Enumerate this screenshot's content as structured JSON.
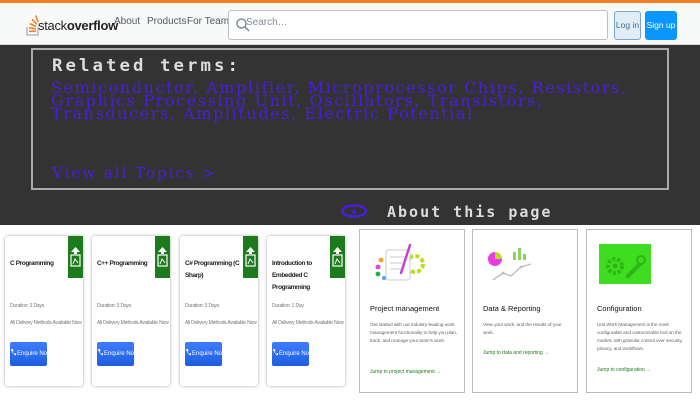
{
  "header": {
    "logo_text_light": "stack",
    "logo_text_bold": "overflow",
    "nav": [
      "About",
      "Products",
      "For Teams"
    ],
    "search_placeholder": "Search…",
    "login_label": "Log in",
    "signup_label": "Sign up"
  },
  "related": {
    "title": "Related terms:",
    "terms": "Semiconductor, Amplifier, Microprocessor Chips, Resistors, Graphics Processing Unit, Oscillators, Transistors, Transducers, Amplitudes, Electric Potential",
    "view_all": "View all Topics >",
    "about": "About this page"
  },
  "courses": [
    {
      "title": "C Programming",
      "duration": "Duration: 3 Days",
      "delivery": "All Delivery Methods Available Now",
      "enquire": "Enquire Now"
    },
    {
      "title": "C++ Programming",
      "duration": "Duration: 3 Days",
      "delivery": "All Delivery Methods Available Now",
      "enquire": "Enquire Now"
    },
    {
      "title": "C# Programming (C Sharp)",
      "duration": "Duration: 3 Days",
      "delivery": "All Delivery Methods Available Now",
      "enquire": "Enquire Now"
    },
    {
      "title": "Introduction to Embedded C Programming",
      "duration": "Duration: 1 Day",
      "delivery": "All Delivery Methods Available Now",
      "enquire": "Enquire Now"
    }
  ],
  "features": [
    {
      "title": "Project management",
      "desc": "Get started with our industry-leading work management functionality to help you plan, track, and manage your team's work.",
      "link": "Jump to project management →",
      "icon": "project-management-illustration"
    },
    {
      "title": "Data & Reporting",
      "desc": "View your work, and the results of your work.",
      "link": "Jump to data and reporting →",
      "icon": "data-reporting-illustration"
    },
    {
      "title": "Configuration",
      "desc": "Unit Work Management is the most configurable and customizable tool on the market, with granular control over security, privacy, and workflows.",
      "link": "Jump to configuration →",
      "icon": "configuration-illustration"
    }
  ],
  "colors": {
    "so_orange": "#f48024",
    "so_blue": "#0a95ff",
    "dark_band": "#333333",
    "term_purple": "#4a1edd",
    "badge_green": "#1d7b1d",
    "config_green": "#3fdd1f"
  }
}
